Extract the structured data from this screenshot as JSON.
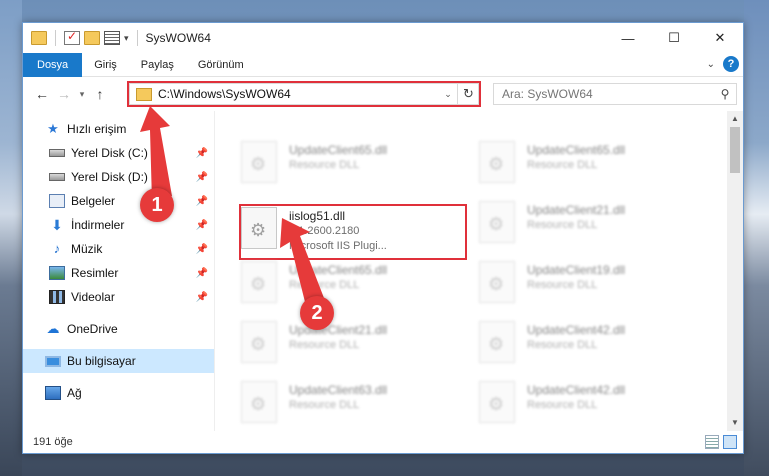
{
  "window": {
    "title": "SysWOW64"
  },
  "ribbon": {
    "tabs": [
      "Dosya",
      "Giriş",
      "Paylaş",
      "Görünüm"
    ]
  },
  "address": {
    "path": "C:\\Windows\\SysWOW64"
  },
  "search": {
    "placeholder": "Ara: SysWOW64"
  },
  "nav": {
    "quick_access": "Hızlı erişim",
    "items": [
      "Yerel Disk (C:)",
      "Yerel Disk (D:)",
      "Belgeler",
      "İndirmeler",
      "Müzik",
      "Resimler",
      "Videolar"
    ],
    "onedrive": "OneDrive",
    "this_pc": "Bu bilgisayar",
    "network": "Ağ"
  },
  "files": {
    "col1": [
      {
        "name": "UpdateClient65.dll",
        "sub": "Resource DLL"
      },
      {
        "name": "iislog51.dll",
        "version": "5.1.2600.2180",
        "desc": "Microsoft IIS Plugi..."
      },
      {
        "name": "UpdateClient65.dll",
        "sub": "Resource DLL"
      },
      {
        "name": "UpdateClient21.dll",
        "sub": "Resource DLL"
      },
      {
        "name": "UpdateClient63.dll",
        "sub": "Resource DLL"
      }
    ],
    "col2": [
      {
        "name": "UpdateClient65.dll",
        "sub": "Resource DLL"
      },
      {
        "name": "UpdateClient21.dll",
        "sub": "Resource DLL"
      },
      {
        "name": "UpdateClient19.dll",
        "sub": "Resource DLL"
      },
      {
        "name": "UpdateClient42.dll",
        "sub": "Resource DLL"
      },
      {
        "name": "UpdateClient42.dll",
        "sub": "Resource DLL"
      }
    ]
  },
  "status": {
    "count": "191 öğe"
  },
  "callouts": [
    "1",
    "2"
  ],
  "colors": {
    "accent": "#1979ca",
    "highlight": "#e0303a"
  }
}
